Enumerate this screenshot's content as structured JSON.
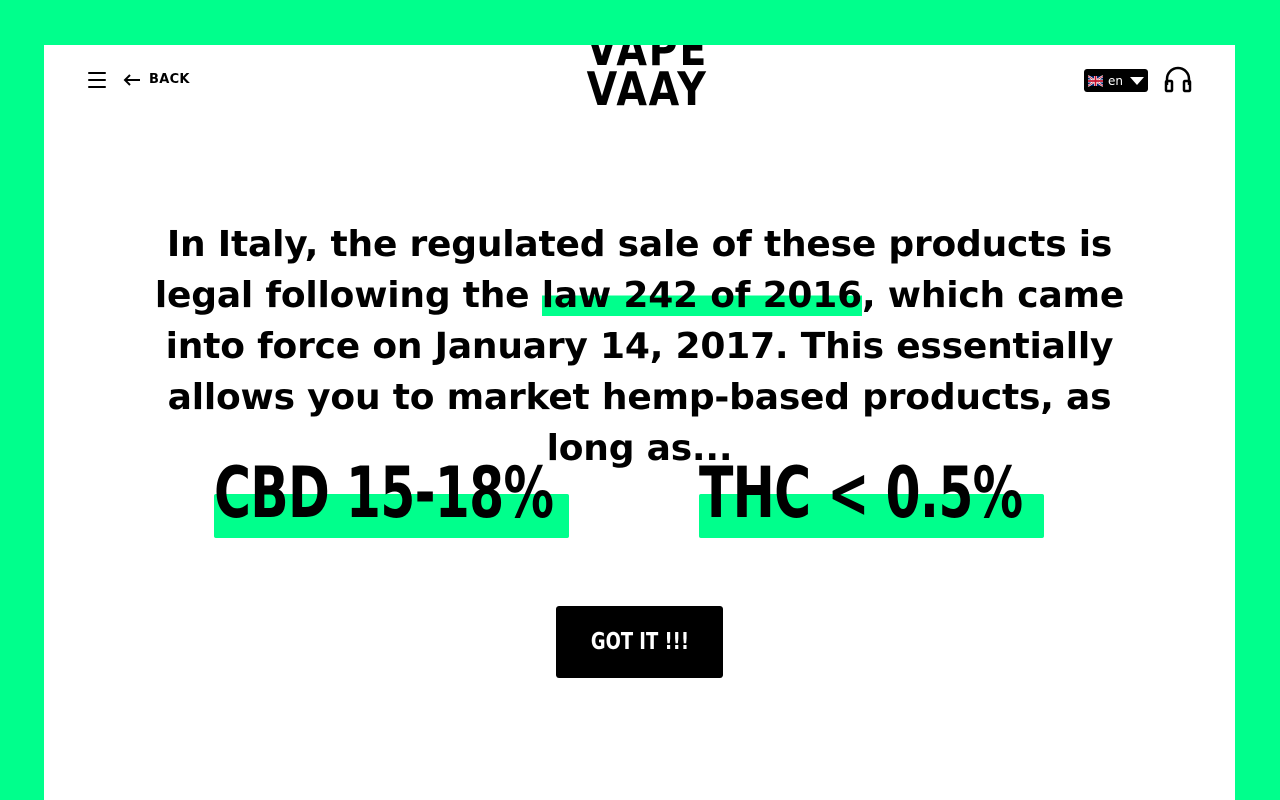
{
  "header": {
    "menu_icon": "hamburger-menu-icon",
    "back_icon": "arrow-left-icon",
    "back_label": "BACK",
    "logo_line1": "VAPE",
    "logo_line2": "VAAY",
    "language": {
      "flag_icon": "uk-flag-icon",
      "code": "en",
      "caret_icon": "caret-down-icon"
    },
    "support_icon": "headphones-icon"
  },
  "main": {
    "statement": {
      "part1": "In Italy, the regulated sale of these products is legal following the ",
      "highlight": "law 242 of 2016",
      "part2": ", which came into force on January 14, 2017. This essentially allows you to market hemp-based products, as long as..."
    },
    "stats": [
      {
        "label": "CBD 15-18%"
      },
      {
        "label": "THC < 0.5%"
      }
    ],
    "cta_label": "GOT IT !!!"
  },
  "colors": {
    "accent": "#00FF8C",
    "background": "#FFFFFF",
    "text": "#000000"
  }
}
